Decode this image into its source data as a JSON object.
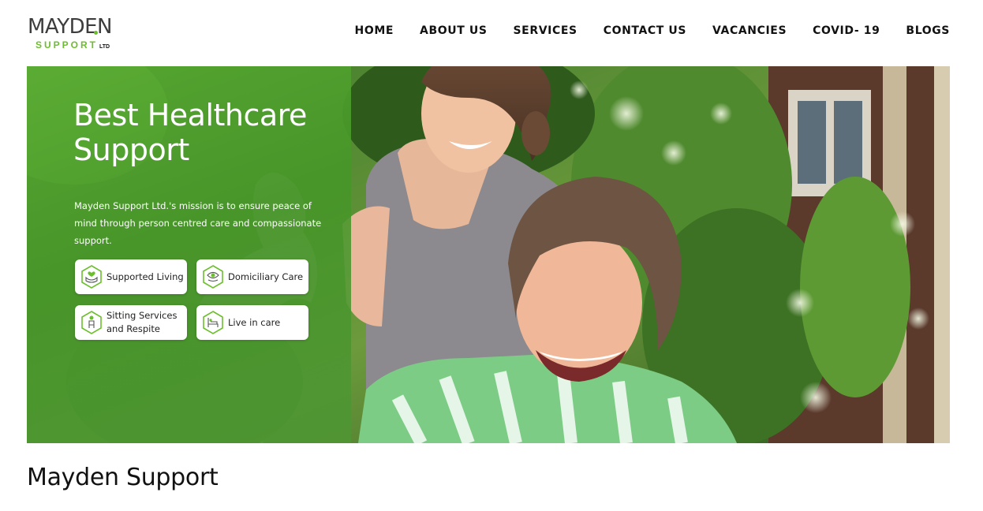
{
  "logo": {
    "brand": "MAYDEN",
    "support": "SUPPORT",
    "ltd": "LTD"
  },
  "nav": {
    "items": [
      {
        "label": "HOME"
      },
      {
        "label": "ABOUT US"
      },
      {
        "label": "SERVICES"
      },
      {
        "label": "CONTACT US"
      },
      {
        "label": "VACANCIES"
      },
      {
        "label": "COVID- 19"
      },
      {
        "label": "BLOGS"
      }
    ]
  },
  "hero": {
    "title": "Best Healthcare Support",
    "description": "Mayden Support Ltd.'s mission is to ensure peace of mind through person centred care and compassionate support.",
    "services": [
      {
        "label": "Supported Living",
        "icon": "hands-heart-icon"
      },
      {
        "label": "Domiciliary Care",
        "icon": "eye-hand-icon"
      },
      {
        "label": "Sitting Services\nand Respite",
        "icon": "person-seated-icon"
      },
      {
        "label": "Live in care",
        "icon": "bed-care-icon"
      }
    ]
  },
  "main": {
    "section_title": "Mayden Support"
  },
  "colors": {
    "accent": "#6cbf2c",
    "hero_overlay": "#58aa32"
  }
}
